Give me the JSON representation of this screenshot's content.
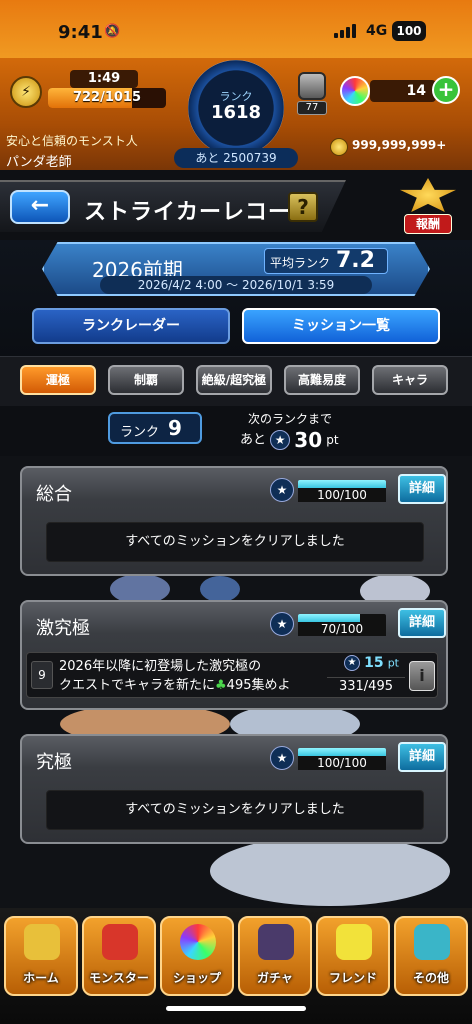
{
  "status": {
    "time": "9:41",
    "network": "4G",
    "battery": "100"
  },
  "header": {
    "stamina_timer": "1:49",
    "stamina_value": "722/1015",
    "stamina_fraction": 0.71,
    "rank_label": "ランク",
    "rank_value": "1618",
    "next_rank_text": "あと 2500739",
    "item_count": "77",
    "orb_count": "14",
    "user_title": "安心と信頼のモンスト人",
    "user_name": "パンダ老師",
    "gold": "999,999,999+"
  },
  "title_bar": {
    "title": "ストライカーレコード",
    "back_icon": "←",
    "help_icon": "?",
    "reward_label": "報酬"
  },
  "season": {
    "name": "2026前期",
    "avg_rank_label": "平均ランク",
    "avg_rank_value": "7.2",
    "period": "2026/4/2 4:00 ～ 2026/10/1 3:59",
    "radar_button": "ランクレーダー",
    "missions_button": "ミッション一覧"
  },
  "tabs": [
    {
      "label": "運極",
      "active": true
    },
    {
      "label": "制覇",
      "active": false
    },
    {
      "label": "絶級/超究極",
      "active": false
    },
    {
      "label": "高難易度",
      "active": false
    },
    {
      "label": "キャラ",
      "active": false
    }
  ],
  "rank_status": {
    "rank_label": "ランク",
    "rank_value": "9",
    "next_label": "次のランクまで",
    "next_prefix": "あと",
    "next_points": "30",
    "next_unit": "pt"
  },
  "cards": {
    "sogo": {
      "name": "総合",
      "progress": "100/100",
      "progress_fraction": 1.0,
      "detail": "詳細",
      "message": "すべてのミッションをクリアしました"
    },
    "gekikyu": {
      "name": "激究極",
      "progress": "70/100",
      "progress_fraction": 0.7,
      "detail": "詳細",
      "mission": {
        "number": "9",
        "text_line1": "2026年以降に初登場した激究極の",
        "text_line2_a": "クエストでキャラを新たに",
        "text_line2_b": "495集めよ",
        "reward_points": "15",
        "reward_unit": "pt",
        "count": "331/495",
        "info_icon": "i"
      }
    },
    "kyukyoku": {
      "name": "究極",
      "progress": "100/100",
      "progress_fraction": 1.0,
      "detail": "詳細",
      "message": "すべてのミッションをクリアしました"
    }
  },
  "bottom_nav": [
    {
      "label": "ホーム",
      "icon": "home-icon"
    },
    {
      "label": "モンスター",
      "icon": "monster-icon"
    },
    {
      "label": "ショップ",
      "icon": "shop-orb-icon"
    },
    {
      "label": "ガチャ",
      "icon": "gacha-icon"
    },
    {
      "label": "フレンド",
      "icon": "friend-icon"
    },
    {
      "label": "その他",
      "icon": "other-icon"
    }
  ]
}
